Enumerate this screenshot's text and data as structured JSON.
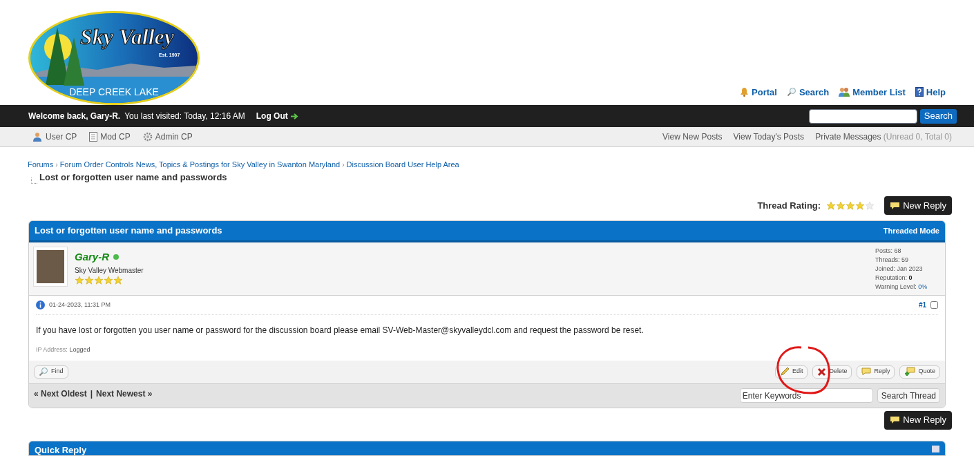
{
  "logo": {
    "title": "Sky Valley",
    "established": "Est. 1907",
    "caption": "DEEP CREEK LAKE"
  },
  "top_links": [
    {
      "label": "Portal"
    },
    {
      "label": "Search"
    },
    {
      "label": "Member List"
    },
    {
      "label": "Help"
    }
  ],
  "welcome_bar": {
    "greeting": "Welcome back, Gary-R.",
    "last_visit": "You last visited: Today, 12:16 AM",
    "logout": "Log Out",
    "search_button": "Search"
  },
  "nav_left": [
    {
      "label": "User CP"
    },
    {
      "label": "Mod CP"
    },
    {
      "label": "Admin CP"
    }
  ],
  "nav_right": [
    {
      "label": "View New Posts"
    },
    {
      "label": "View Today's Posts"
    },
    {
      "label": "Private Messages",
      "note": "(Unread 0, Total 0)"
    }
  ],
  "breadcrumbs": [
    {
      "kind": "link",
      "text": "Forums"
    },
    {
      "kind": "separator",
      "text": "›"
    },
    {
      "kind": "link",
      "text": "Forum Order Controls News, Topics & Postings for Sky Valley in Swanton Maryland"
    },
    {
      "kind": "separator",
      "text": "›"
    },
    {
      "kind": "link",
      "text": "Discussion Board User Help Area"
    }
  ],
  "page_title": "Lost or forgotten user name and passwords",
  "thread_rating": {
    "label": "Thread Rating:",
    "stars": 4
  },
  "new_reply_top": "New Reply",
  "thread": {
    "title": "Lost or forgotten user name and passwords",
    "mode": "Threaded Mode"
  },
  "post": {
    "author": "Gary-R",
    "online": true,
    "user_title": "Sky Valley Webmaster",
    "stars": 5,
    "stats": [
      {
        "label": "Posts:",
        "value": "68"
      },
      {
        "label": "Threads:",
        "value": "59"
      },
      {
        "label": "Joined:",
        "value": "Jan 2023"
      },
      {
        "label": "Reputation:",
        "value": "0",
        "kind": "bold"
      },
      {
        "label": "Warning Level:",
        "value": "0%",
        "kind": "link"
      }
    ],
    "date": "01-24-2023, 11:31 PM",
    "number": "#1",
    "selected": false,
    "body": "If you have lost or forgotten you user name or password for the discussion board please email SV-Web-Master@skyvalleydcl.com and request the password be reset.",
    "ip_label": "IP Address:",
    "ip_value": "Logged",
    "find": "Find",
    "actions": [
      {
        "label": "Edit"
      },
      {
        "label": "Delete"
      },
      {
        "label": "Reply"
      },
      {
        "label": "Quote"
      }
    ]
  },
  "thread_nav": {
    "prev": "« Next Oldest",
    "separator": "|",
    "next": "Next Newest »",
    "search_placeholder": "Enter Keywords",
    "search_button": "Search Thread"
  },
  "new_reply_bottom": "New Reply",
  "quick_reply": {
    "title": "Quick Reply"
  }
}
